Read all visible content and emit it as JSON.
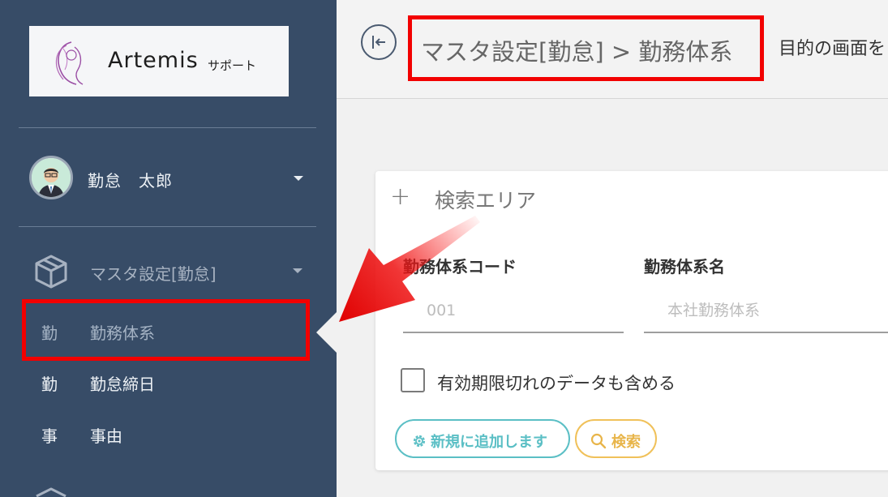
{
  "logo": {
    "name": "Artemis",
    "sub": "サポート"
  },
  "user": {
    "name": "勤怠　太郎"
  },
  "sidebar": {
    "group_label": "マスタ設定[勤怠]",
    "items": [
      {
        "abbr": "勤",
        "label": "勤務体系",
        "active": true
      },
      {
        "abbr": "勤",
        "label": "勤怠締日",
        "active": false
      },
      {
        "abbr": "事",
        "label": "事由",
        "active": false
      }
    ]
  },
  "header": {
    "title": "マスタ設定[勤怠] > 勤務体系",
    "hint": "目的の画面を"
  },
  "search": {
    "title": "検索エリア",
    "fields": [
      {
        "label": "勤務体系コード",
        "placeholder": "001",
        "value": ""
      },
      {
        "label": "勤務体系名",
        "placeholder": "本社勤務体系",
        "value": ""
      }
    ],
    "checkbox_label": "有効期限切れのデータも含める",
    "checkbox_checked": false,
    "add_button": "新規に追加します",
    "search_button": "検索"
  },
  "colors": {
    "sidebar_bg": "#374c67",
    "highlight": "#f20000",
    "add_accent": "#5bbfc5",
    "search_accent": "#f0c15a"
  },
  "icons": [
    "logo-mark-icon",
    "chevron-down-icon",
    "box-icon",
    "collapse-sidebar-icon",
    "plus-icon",
    "gear-icon",
    "search-icon",
    "arrow-annotation"
  ]
}
